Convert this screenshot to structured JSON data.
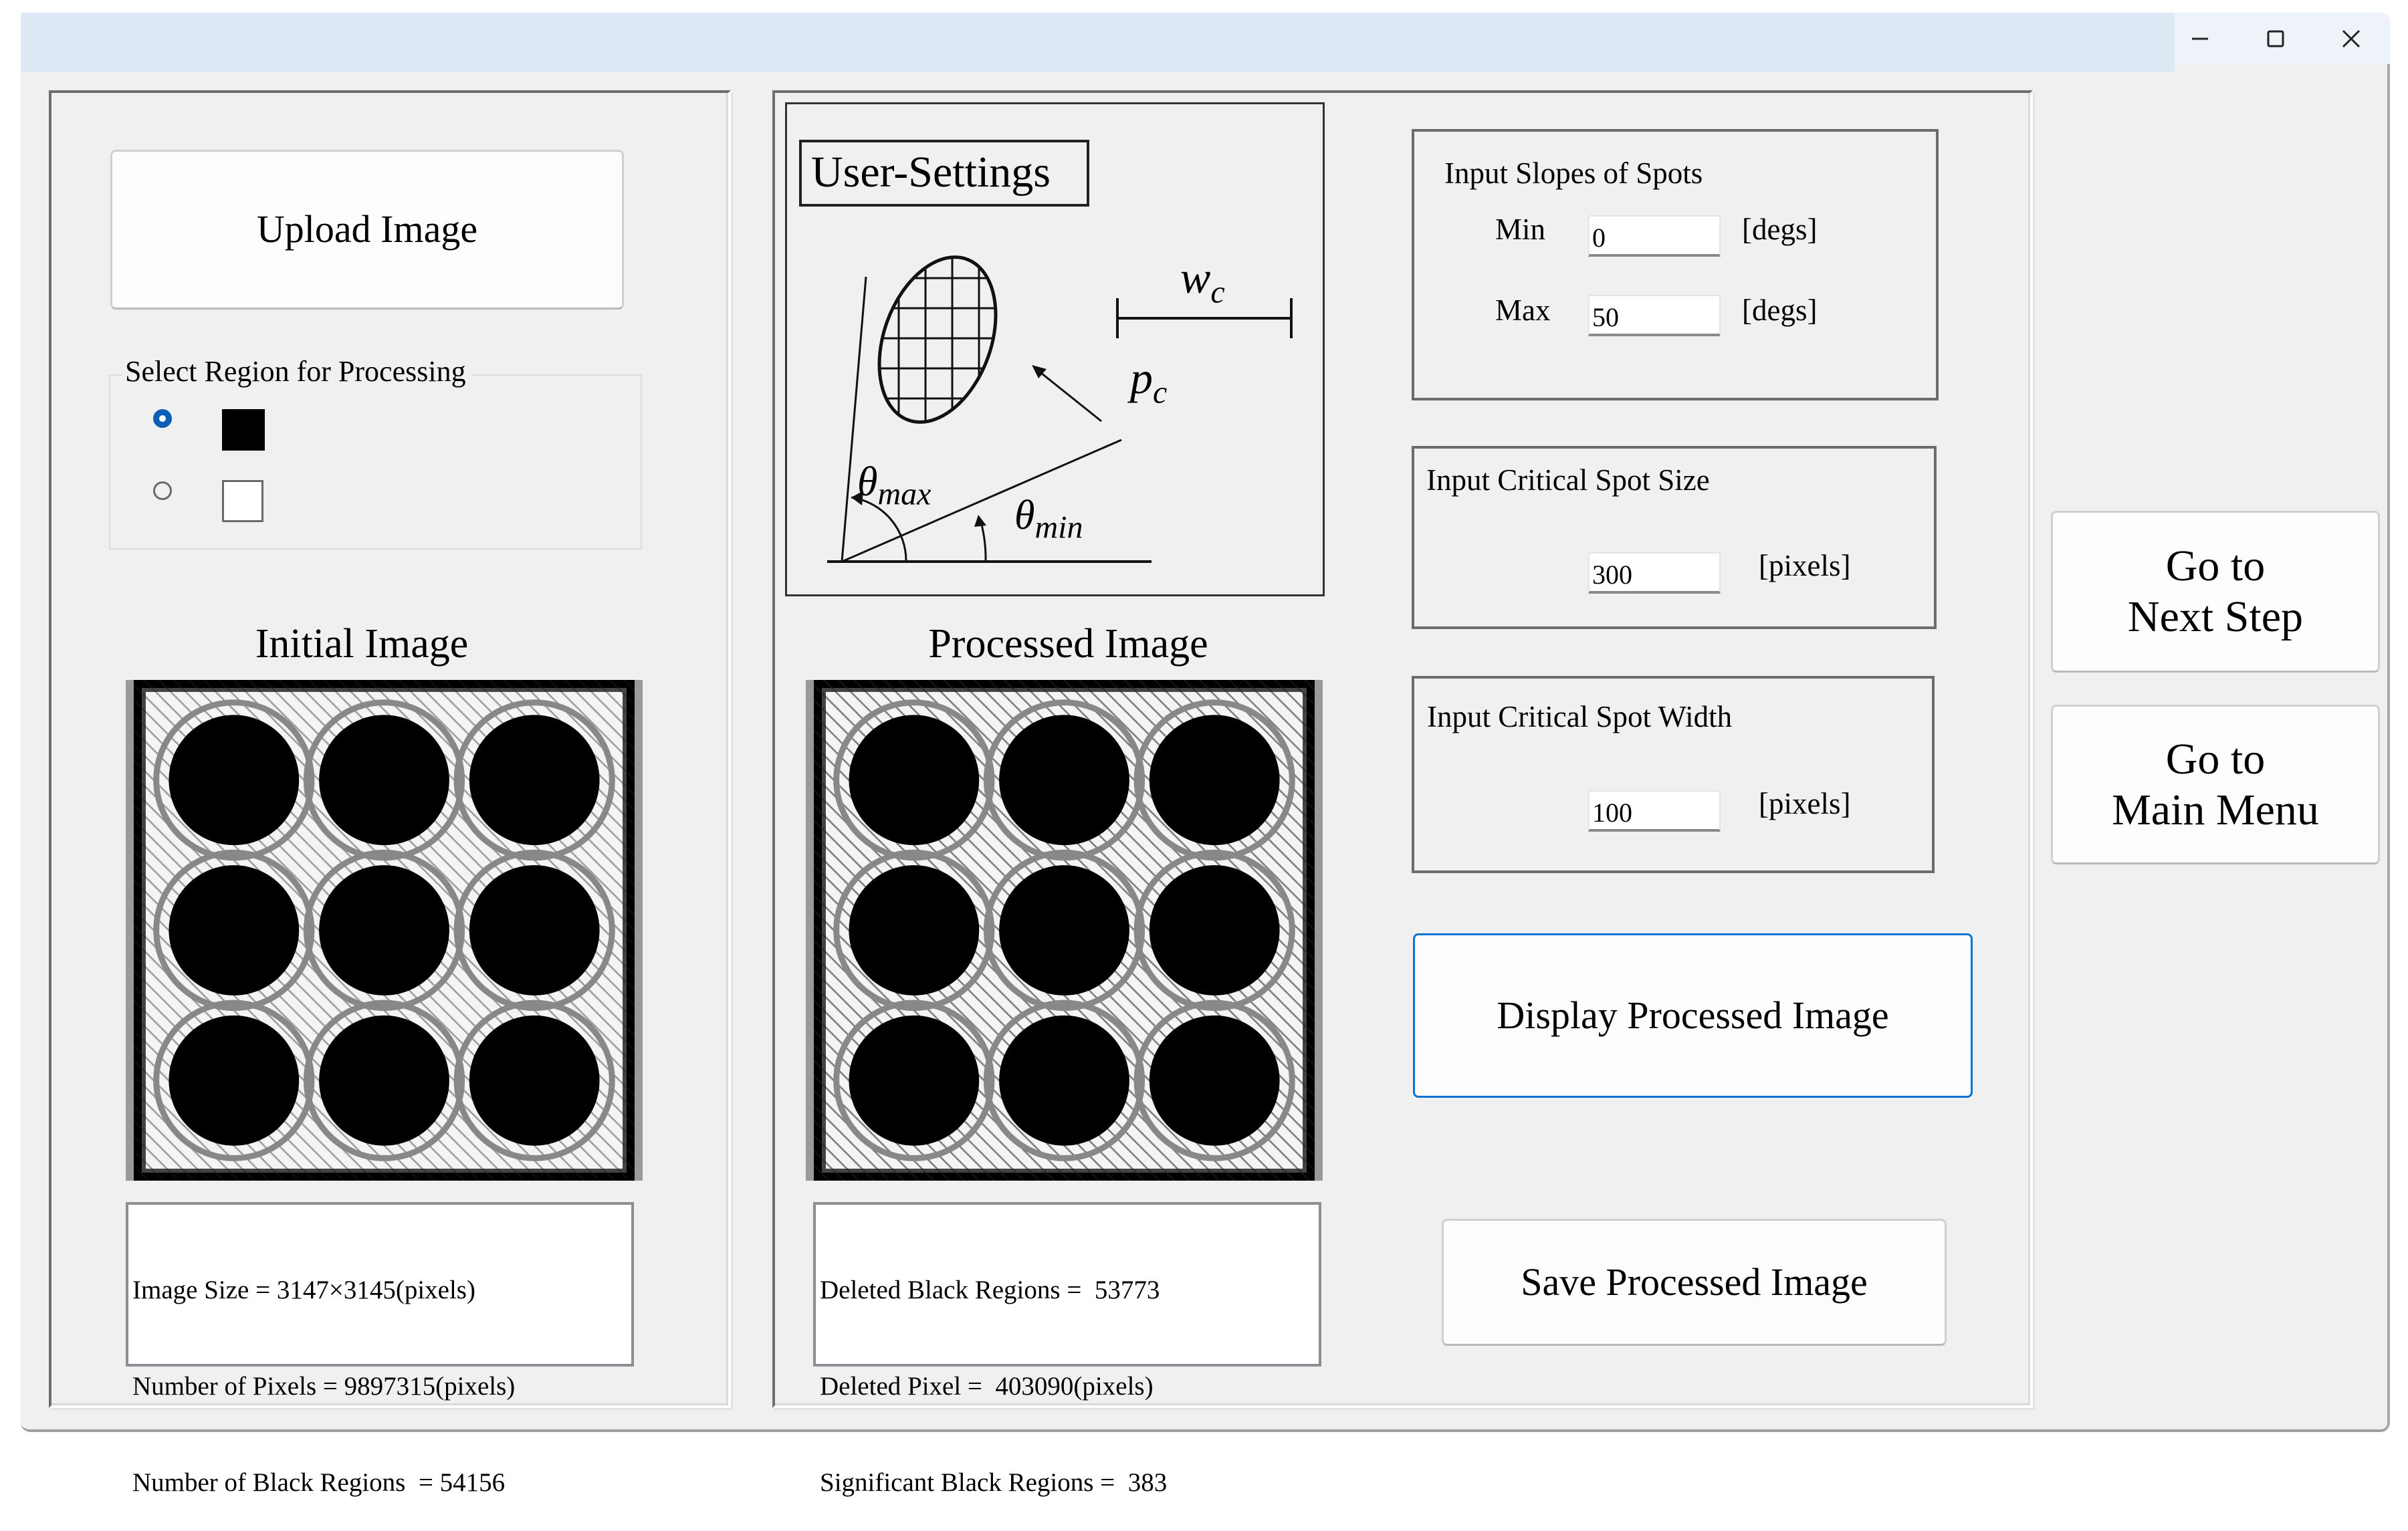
{
  "window": {
    "title": "",
    "controls": {
      "minimize": "—",
      "maximize": "☐",
      "close": "✕"
    }
  },
  "left_panel": {
    "upload_button": "Upload Image",
    "region_group": {
      "label": "Select Region for Processing",
      "options": [
        {
          "swatch": "black",
          "swatch_color": "#000000",
          "selected": true
        },
        {
          "swatch": "white",
          "swatch_color": "#ffffff",
          "selected": false
        }
      ]
    },
    "image_title": "Initial Image",
    "info_lines": [
      "Image Size = 3147×3145(pixels)",
      "Number of Pixels = 9897315(pixels)",
      "Number of Black Regions  = 54156"
    ]
  },
  "middle_panel": {
    "diagram": {
      "title": "User-Settings",
      "labels": {
        "width": "w",
        "width_sub": "c",
        "size": "p",
        "size_sub": "c",
        "theta_max": "θ",
        "theta_max_sub": "max",
        "theta_min": "θ",
        "theta_min_sub": "min"
      }
    },
    "image_title": "Processed Image",
    "info_lines": [
      "Deleted Black Regions =  53773",
      "Deleted Pixel =  403090(pixels)",
      "Significant Black Regions =  383"
    ]
  },
  "settings": {
    "slopes": {
      "title": "Input Slopes of Spots",
      "min_label": "Min",
      "min_value": "0",
      "max_label": "Max",
      "max_value": "50",
      "unit": "[degs]"
    },
    "spot_size": {
      "title": "Input Critical Spot Size",
      "value": "300",
      "unit": "[pixels]"
    },
    "spot_width": {
      "title": "Input Critical Spot Width",
      "value": "100",
      "unit": "[pixels]"
    },
    "display_button": "Display Processed Image",
    "save_button": "Save Processed Image"
  },
  "nav": {
    "next_step_line1": "Go to",
    "next_step_line2": "Next Step",
    "main_menu_line1": "Go to",
    "main_menu_line2": "Main Menu"
  },
  "colors": {
    "titlebar": "#dde9f4",
    "window_bg": "#f0f0f0",
    "focus_accent": "#0a74d4",
    "radio_selected": "#0a5fb4"
  }
}
